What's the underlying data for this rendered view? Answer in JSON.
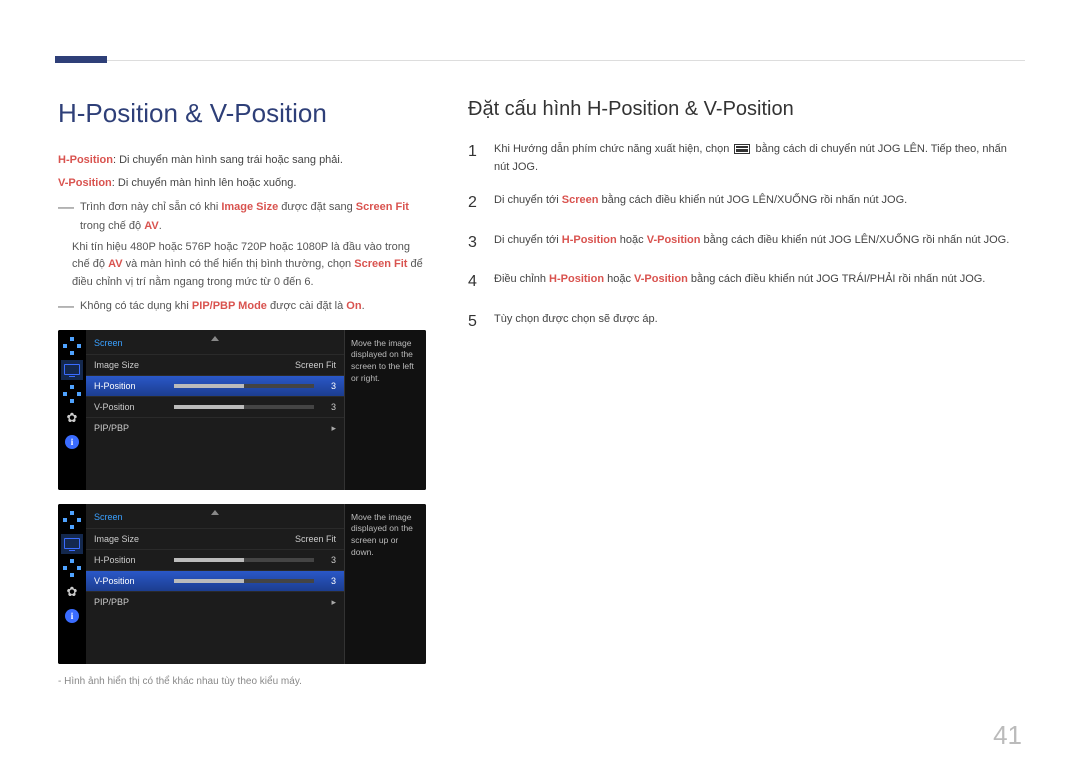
{
  "page_number": "41",
  "title": "H-Position & V-Position",
  "left": {
    "desc_h_label": "H-Position",
    "desc_h_text": ": Di chuyển màn hình sang trái hoặc sang phải.",
    "desc_v_label": "V-Position",
    "desc_v_text": ": Di chuyển màn hình lên hoặc xuống.",
    "note1_pre": "Trình đơn này chỉ sẵn có khi ",
    "note1_b1": "Image Size",
    "note1_mid": " được đặt sang ",
    "note1_b2": "Screen Fit",
    "note1_post1": " trong chế độ ",
    "note1_b3": "AV",
    "note1_post2": ".",
    "subnote_pre": "Khi tín hiệu 480P hoặc 576P hoặc 720P hoặc 1080P là đầu vào trong chế độ ",
    "subnote_b1": "AV",
    "subnote_mid": " và màn hình có thể hiển thị bình thường, chọn ",
    "subnote_b2": "Screen Fit",
    "subnote_post": " để điều chỉnh vị trí nằm ngang trong mức từ 0 đến 6.",
    "note2_pre": "Không có tác dụng khi ",
    "note2_b1": "PIP/PBP Mode",
    "note2_mid": " được cài đặt là ",
    "note2_b2": "On",
    "note2_post": ".",
    "footnote": "Hình ảnh hiển thị có thể khác nhau tùy theo kiểu máy."
  },
  "right": {
    "subtitle": "Đặt cấu hình H-Position & V-Position",
    "steps": [
      {
        "num": "1",
        "pre": "Khi Hướng dẫn phím chức năng xuất hiện, chọn ",
        "post": " bằng cách di chuyển nút JOG LÊN. Tiếp theo, nhấn nút JOG."
      },
      {
        "num": "2",
        "pre": "Di chuyển tới ",
        "b1": "Screen",
        "post": " bằng cách điều khiển nút JOG LÊN/XUỐNG rồi nhấn nút JOG."
      },
      {
        "num": "3",
        "pre": "Di chuyển tới ",
        "b1": "H-Position",
        "mid": " hoặc ",
        "b2": "V-Position",
        "post": " bằng cách điều khiển nút JOG LÊN/XUỐNG rồi nhấn nút JOG."
      },
      {
        "num": "4",
        "pre": "Điều chỉnh ",
        "b1": "H-Position",
        "mid": " hoặc ",
        "b2": "V-Position",
        "post": " bằng cách điều khiển nút JOG TRÁI/PHẢI rồi nhấn nút JOG."
      },
      {
        "num": "5",
        "pre": "Tùy chọn được chọn sẽ được áp."
      }
    ]
  },
  "osd": [
    {
      "title": "Screen",
      "side": "Move the image displayed on the screen to the left or right.",
      "rows": [
        {
          "label": "Image Size",
          "value_text": "Screen Fit",
          "selected": false
        },
        {
          "label": "H-Position",
          "value": "3",
          "bar": 50,
          "selected": true
        },
        {
          "label": "V-Position",
          "value": "3",
          "bar": 50,
          "selected": false
        },
        {
          "label": "PIP/PBP",
          "caret": true,
          "selected": false
        }
      ]
    },
    {
      "title": "Screen",
      "side": "Move the image displayed on the screen up or down.",
      "rows": [
        {
          "label": "Image Size",
          "value_text": "Screen Fit",
          "selected": false
        },
        {
          "label": "H-Position",
          "value": "3",
          "bar": 50,
          "selected": false
        },
        {
          "label": "V-Position",
          "value": "3",
          "bar": 50,
          "selected": true
        },
        {
          "label": "PIP/PBP",
          "caret": true,
          "selected": false
        }
      ]
    }
  ]
}
